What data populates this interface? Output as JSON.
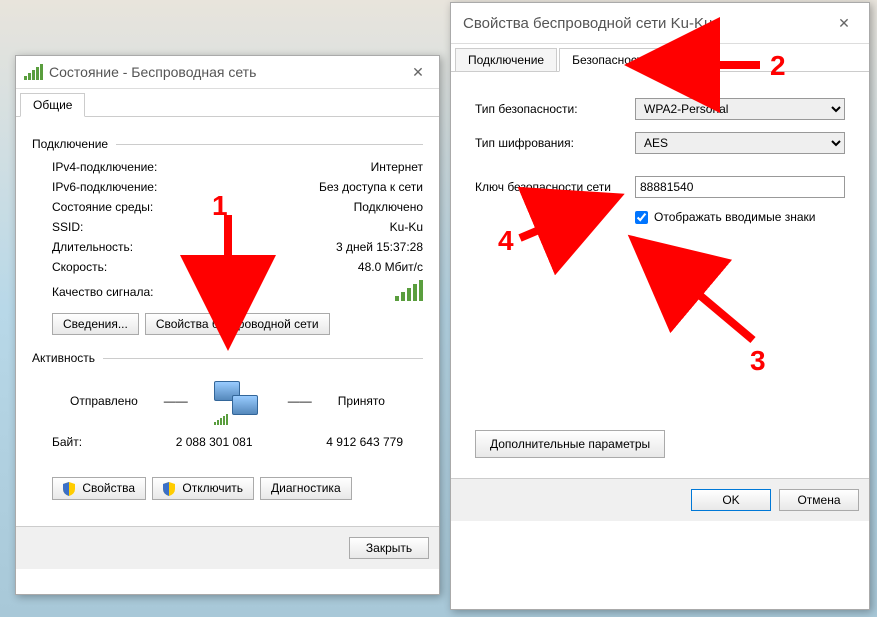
{
  "status_window": {
    "title": "Состояние - Беспроводная сеть",
    "tab_general": "Общие",
    "connection_section": "Подключение",
    "ipv4_label": "IPv4-подключение:",
    "ipv4_value": "Интернет",
    "ipv6_label": "IPv6-подключение:",
    "ipv6_value": "Без доступа к сети",
    "media_state_label": "Состояние среды:",
    "media_state_value": "Подключено",
    "ssid_label": "SSID:",
    "ssid_value": "Ku-Ku",
    "duration_label": "Длительность:",
    "duration_value": "3 дней 15:37:28",
    "speed_label": "Скорость:",
    "speed_value": "48.0 Мбит/с",
    "signal_label": "Качество сигнала:",
    "details_btn": "Сведения...",
    "wireless_props_btn": "Свойства беспроводной сети",
    "activity_section": "Активность",
    "sent_label": "Отправлено",
    "recv_label": "Принято",
    "bytes_label": "Байт:",
    "bytes_sent": "2 088 301 081",
    "bytes_recv": "4 912 643 779",
    "props_btn": "Свойства",
    "disable_btn": "Отключить",
    "diag_btn": "Диагностика",
    "close_btn": "Закрыть"
  },
  "props_window": {
    "title": "Свойства беспроводной сети Ku-Ku",
    "tab_connection": "Подключение",
    "tab_security": "Безопасность",
    "sec_type_label": "Тип безопасности:",
    "sec_type_value": "WPA2-Personal",
    "enc_type_label": "Тип шифрования:",
    "enc_type_value": "AES",
    "key_label": "Ключ безопасности сети",
    "key_value": "88881540",
    "show_chars_label": "Отображать вводимые знаки",
    "advanced_btn": "Дополнительные параметры",
    "ok_btn": "OK",
    "cancel_btn": "Отмена"
  },
  "annotations": {
    "n1": "1",
    "n2": "2",
    "n3": "3",
    "n4": "4"
  }
}
